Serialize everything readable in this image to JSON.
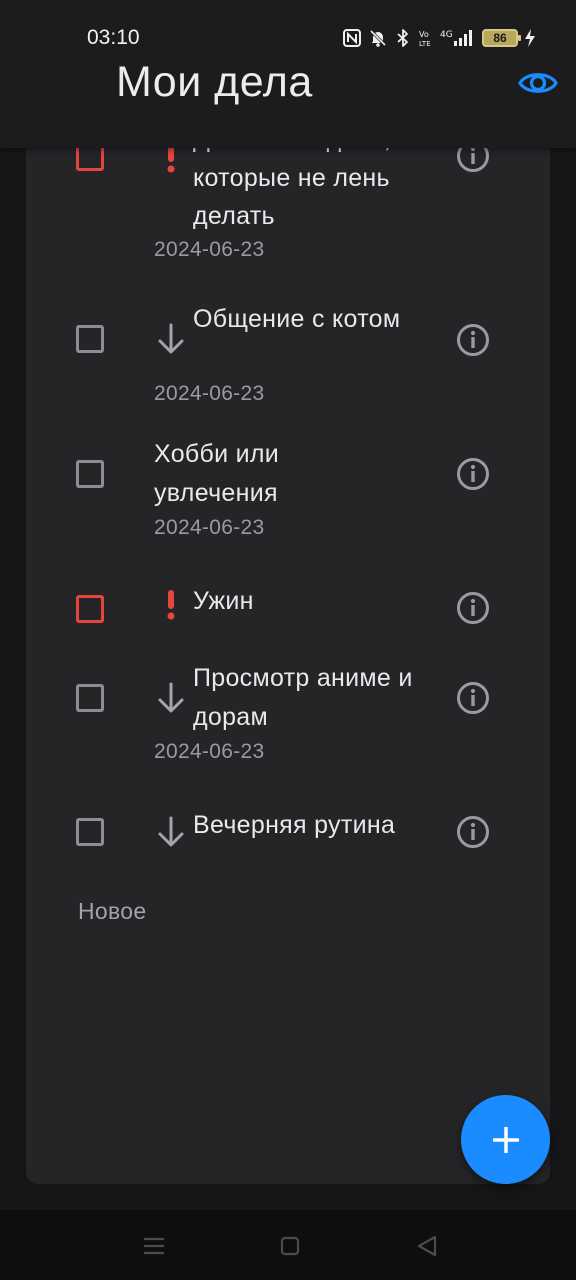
{
  "status_bar": {
    "time": "03:10",
    "battery_level": "86",
    "icons": [
      "nfc-icon",
      "bell-off-icon",
      "bluetooth-icon",
      "volte-icon",
      "signal-4g-icon",
      "battery-icon",
      "charging-icon"
    ]
  },
  "header": {
    "title": "Мои дела",
    "visibility_icon": "eye-icon"
  },
  "tasks": [
    {
      "title": "Домашние дела, которые не лень делать",
      "date": "2024-06-23",
      "priority": "high",
      "done": false
    },
    {
      "title": "Общение с котом",
      "date": "2024-06-23",
      "priority": "low",
      "done": false
    },
    {
      "title": "Хобби или увлечения",
      "date": "2024-06-23",
      "priority": "none",
      "done": false
    },
    {
      "title": "Ужин",
      "date": "",
      "priority": "high",
      "done": false
    },
    {
      "title": "Просмотр аниме и дорам",
      "date": "2024-06-23",
      "priority": "low",
      "done": false
    },
    {
      "title": "Вечерняя рутина",
      "date": "",
      "priority": "low",
      "done": false
    }
  ],
  "new_item_label": "Новое",
  "fab": {
    "icon": "plus-icon"
  },
  "colors": {
    "accent": "#1A8CFF",
    "high_priority": "#E5473D",
    "background": "#161618",
    "card": "#252528"
  }
}
